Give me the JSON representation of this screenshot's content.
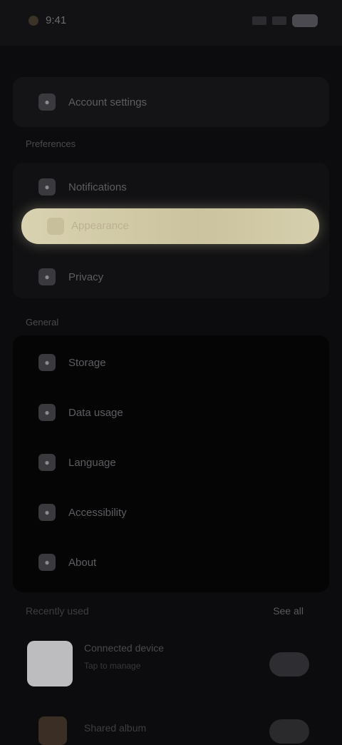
{
  "status": {
    "time": "9:41"
  },
  "top_item": {
    "label": "Account settings",
    "icon": "user-icon"
  },
  "section1": {
    "title": "Preferences",
    "items": [
      {
        "label": "Notifications",
        "icon": "bell-icon"
      },
      {
        "label": "Appearance",
        "icon": "palette-icon"
      },
      {
        "label": "Privacy",
        "icon": "lock-icon"
      }
    ]
  },
  "section2": {
    "title": "General",
    "items": [
      {
        "label": "Storage",
        "icon": "folder-icon"
      },
      {
        "label": "Data usage",
        "icon": "chart-icon"
      },
      {
        "label": "Language",
        "icon": "globe-icon"
      },
      {
        "label": "Accessibility",
        "icon": "accessibility-icon"
      },
      {
        "label": "About",
        "icon": "info-icon"
      }
    ]
  },
  "recent": {
    "title": "Recently used",
    "see_all": "See all",
    "cards": [
      {
        "title": "Connected device",
        "subtitle": "Tap to manage"
      },
      {
        "title": "Shared album"
      }
    ]
  }
}
